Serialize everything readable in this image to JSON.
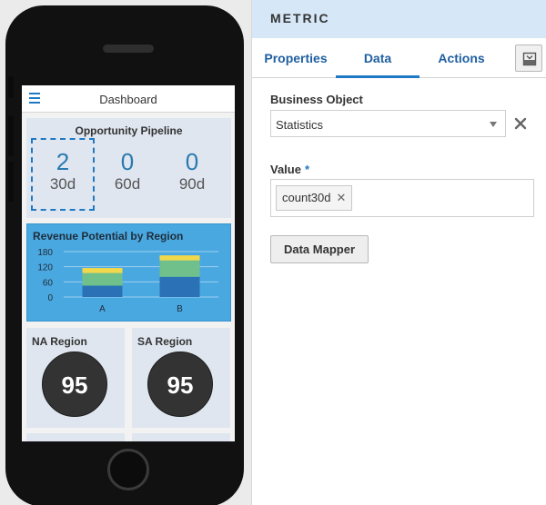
{
  "phone": {
    "header_title": "Dashboard",
    "pipeline": {
      "title": "Opportunity Pipeline",
      "metrics": [
        {
          "value": "2",
          "period": "30d"
        },
        {
          "value": "0",
          "period": "60d"
        },
        {
          "value": "0",
          "period": "90d"
        }
      ]
    },
    "revenue_title": "Revenue Potential by Region",
    "regions": [
      {
        "title": "NA Region",
        "value": "95"
      },
      {
        "title": "SA Region",
        "value": "95"
      }
    ]
  },
  "chart_data": {
    "type": "bar",
    "title": "Revenue Potential by Region",
    "categories": [
      "A",
      "B"
    ],
    "ylim": [
      0,
      180
    ],
    "yticks": [
      0,
      60,
      120,
      180
    ],
    "stacked": true,
    "grid": true,
    "series": [
      {
        "values": [
          45,
          80
        ],
        "color": "#2a72b5"
      },
      {
        "values": [
          50,
          65
        ],
        "color": "#6fc08a"
      },
      {
        "values": [
          20,
          20
        ],
        "color": "#f2d84b"
      }
    ]
  },
  "panel": {
    "header": "METRIC",
    "tabs": [
      "Properties",
      "Data",
      "Actions"
    ],
    "active_tab": "Data",
    "icon_button": "panel-toggle-icon",
    "business_object": {
      "label": "Business Object",
      "value": "Statistics"
    },
    "value_field": {
      "label": "Value",
      "required_mark": "*",
      "chip": "count30d"
    },
    "data_mapper_label": "Data Mapper"
  },
  "colors": {
    "accent": "#1f79c4",
    "header_bg": "#d6e8f8",
    "tile_bg": "#dfe6ef",
    "chart_bg": "#4aa8e0"
  }
}
